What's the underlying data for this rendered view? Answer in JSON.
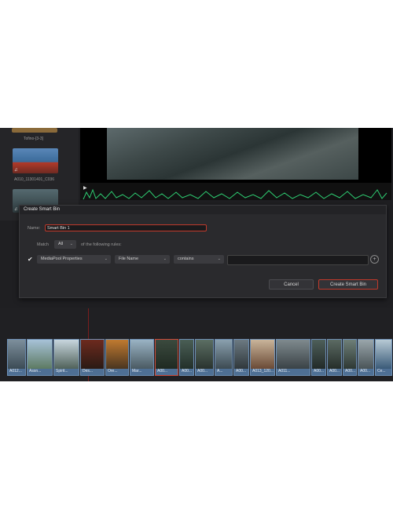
{
  "media_pool": {
    "clips": [
      {
        "caption": "Tofino-[3-3]"
      },
      {
        "caption": "A010_11301401_C036"
      }
    ]
  },
  "dialog": {
    "title": "Create Smart Bin",
    "name_label": "Name:",
    "name_value": "Smart Bin 1",
    "match_label": "Match",
    "match_value": "All",
    "match_suffix": "of the following rules:",
    "rule": {
      "field1": "MediaPool Properties",
      "field2": "File Name",
      "operator": "contains",
      "value": ""
    },
    "cancel_label": "Cancel",
    "create_label": "Create Smart Bin"
  },
  "timeline": {
    "clips": [
      {
        "label": "A012..."
      },
      {
        "label": "Assn..."
      },
      {
        "label": "Spirit..."
      },
      {
        "label": "Des..."
      },
      {
        "label": "Ore..."
      },
      {
        "label": "Mar..."
      },
      {
        "label": "A00..."
      },
      {
        "label": "A00..."
      },
      {
        "label": "A00..."
      },
      {
        "label": "A..."
      },
      {
        "label": "A00..."
      },
      {
        "label": "A013_120..."
      },
      {
        "label": "A011..."
      },
      {
        "label": "A00..."
      },
      {
        "label": "A00..."
      },
      {
        "label": "A00..."
      },
      {
        "label": "A00..."
      },
      {
        "label": "Ce..."
      }
    ]
  },
  "colors": {
    "accent_red": "#c0392b",
    "clip_blue": "#4e6f94",
    "waveform_green": "#2ecc71"
  }
}
